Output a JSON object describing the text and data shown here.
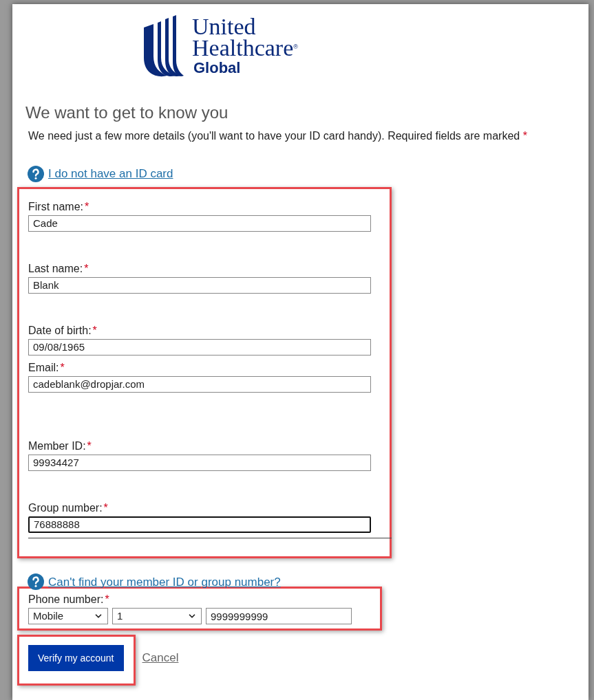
{
  "logo": {
    "line1": "United",
    "line2": "Healthcare",
    "mark": "®",
    "line3": "Global"
  },
  "heading": "We want to get to know you",
  "intro": {
    "text": "We need just a few more details (you'll want to have your ID card handy). Required fields are marked",
    "mark": "*"
  },
  "help_link": "I do not have an ID card",
  "fields": [
    {
      "label": "First name:",
      "required": true,
      "value": "Cade",
      "focused": false
    },
    {
      "label": "Last name:",
      "required": true,
      "value": "Blank",
      "focused": false
    },
    {
      "label": "Date of birth:",
      "required": true,
      "value": "09/08/1965",
      "focused": false
    },
    {
      "label": "Email:",
      "required": true,
      "value": "cadeblank@dropjar.com",
      "focused": false
    },
    {
      "label": "Member ID:",
      "required": true,
      "value": "99934427",
      "focused": false
    },
    {
      "label": "Group number:",
      "required": true,
      "value": "76888888",
      "focused": true
    }
  ],
  "member_help_link": "Can't find your member ID or group number?",
  "phone": {
    "label": "Phone number:",
    "required": true,
    "type": "Mobile",
    "country_code": "1",
    "number": "9999999999"
  },
  "actions": {
    "submit": "Verify my account",
    "cancel": "Cancel"
  }
}
